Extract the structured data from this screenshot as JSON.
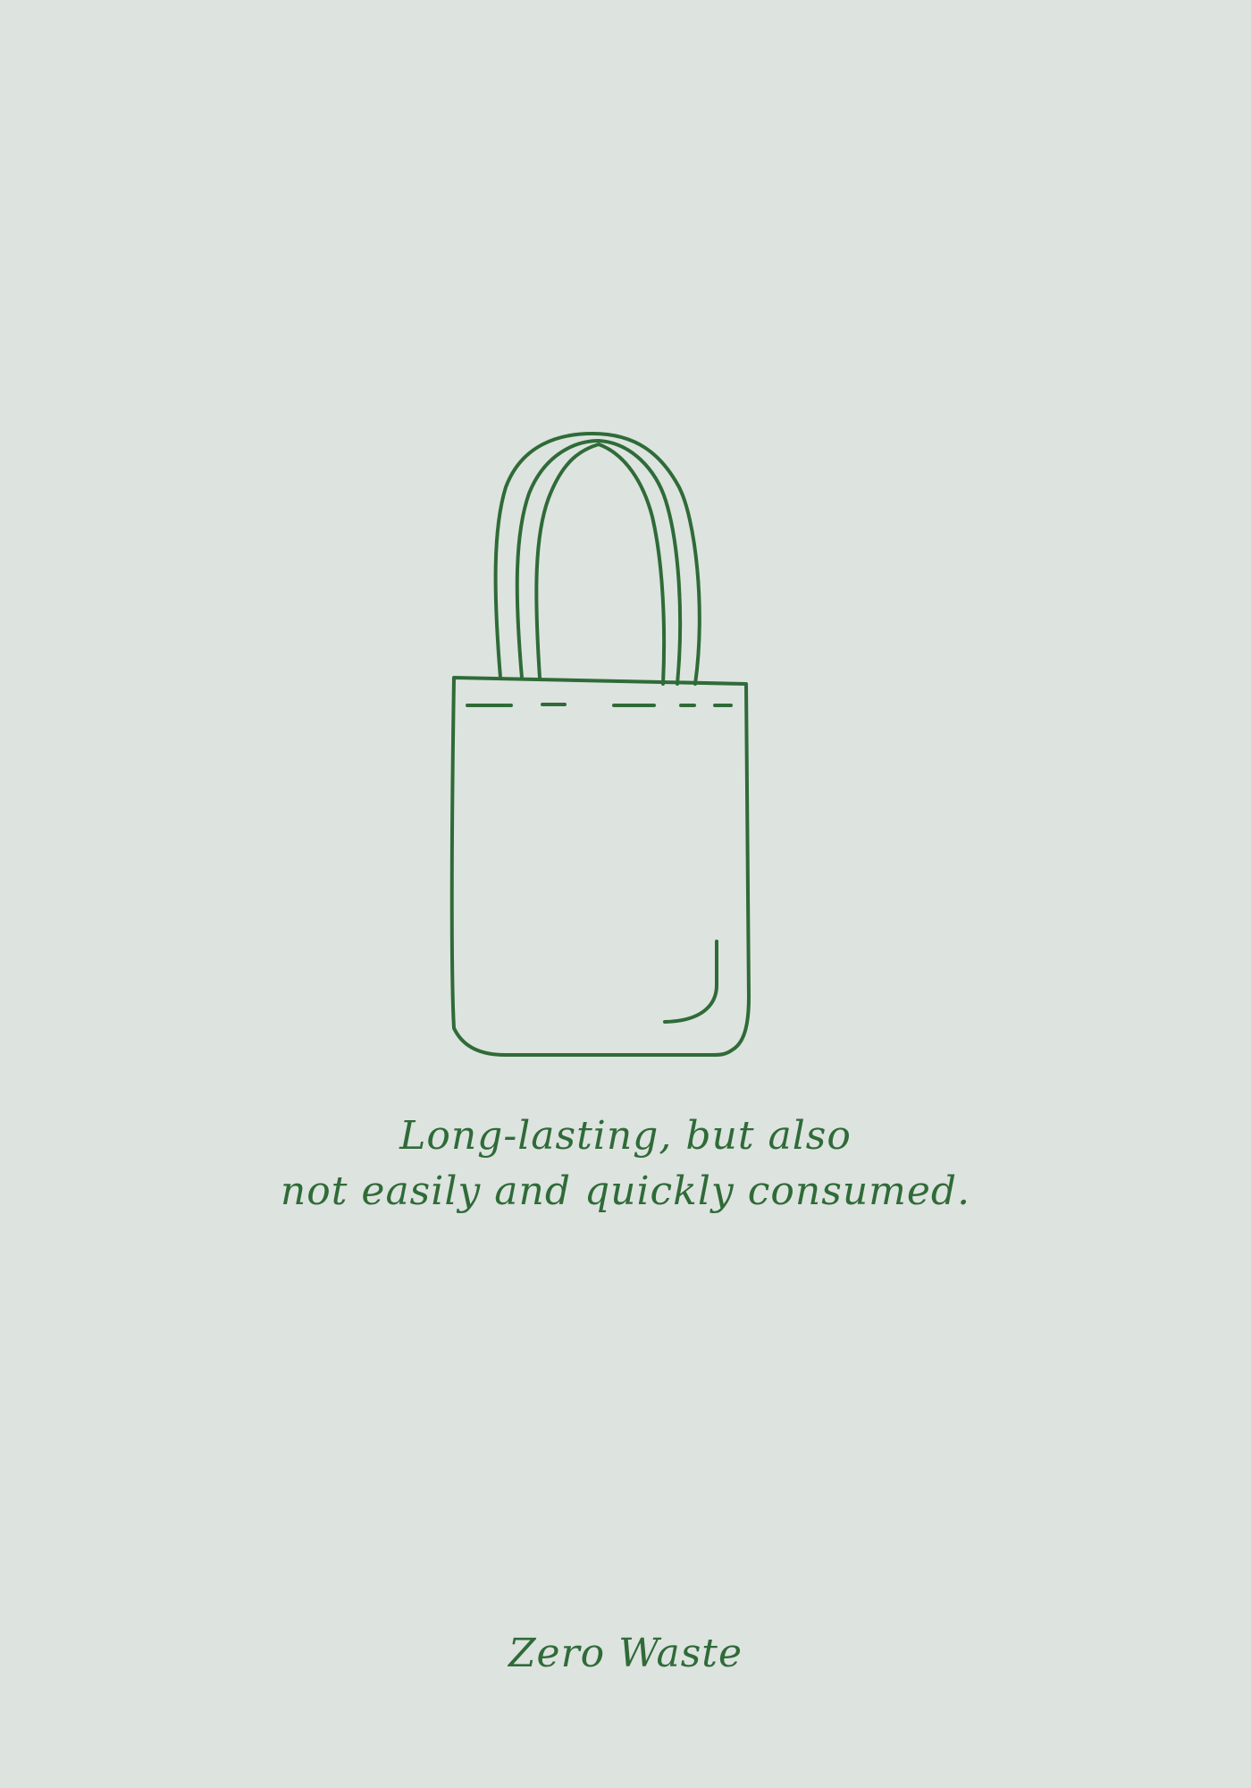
{
  "quote": {
    "line1": "Long-lasting, but also",
    "line2": "not easily and quickly consumed."
  },
  "brand": "Zero Waste",
  "illustration": {
    "icon": "tote-bag-icon",
    "stroke_color": "#2f6b38"
  },
  "colors": {
    "background": "#dde3df",
    "accent": "#2f6b38"
  }
}
